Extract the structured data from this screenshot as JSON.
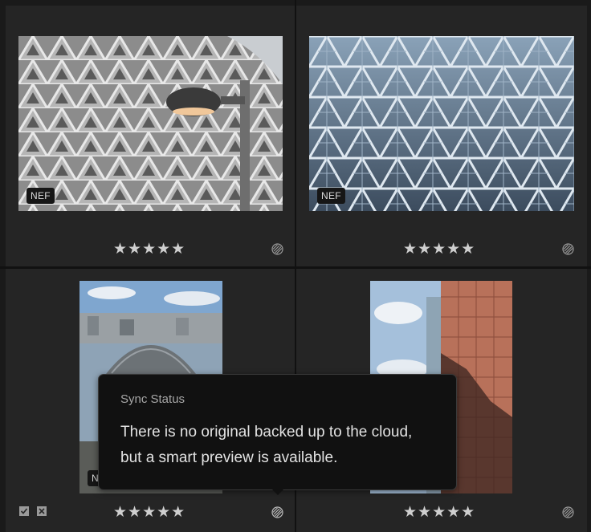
{
  "photos": [
    {
      "badge": "NEF",
      "rating": "★★★★★",
      "thumbnail": "geodesic-dome-with-lamp"
    },
    {
      "badge": "NEF",
      "rating": "★★★★★",
      "thumbnail": "blue-triangle-lattice"
    },
    {
      "badge": "N",
      "rating": "★★★★★",
      "thumbnail": "waterfront-sphere"
    },
    {
      "badge": "",
      "rating": "★★★★★",
      "thumbnail": "copper-glass-building"
    }
  ],
  "icons": {
    "sync": "sync-status-icon",
    "flag_pick": "flag-pick-icon",
    "flag_reject": "flag-reject-icon"
  },
  "tooltip": {
    "title": "Sync Status",
    "line1": "There is no original backed up to the cloud,",
    "line2": "but a smart preview is available."
  },
  "colors": {
    "background": "#1a1a1a",
    "cell": "#252525",
    "tooltip_bg": "#111111",
    "star": "#cfcfcf"
  }
}
